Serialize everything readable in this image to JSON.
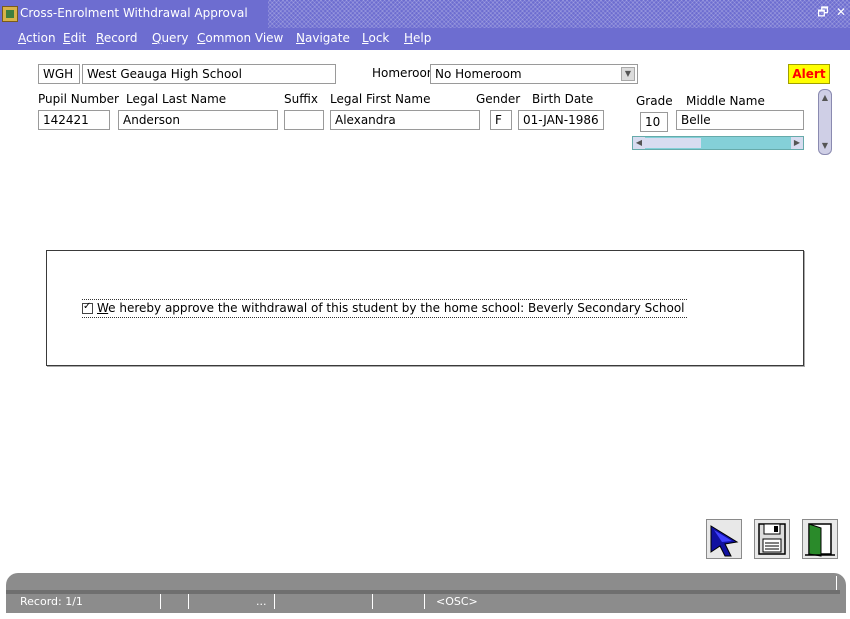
{
  "window": {
    "title": "Cross-Enrolment Withdrawal Approval",
    "restore_glyph": "🗗",
    "close_glyph": "✕"
  },
  "menu": [
    {
      "label": "Action",
      "key": "A"
    },
    {
      "label": "Edit",
      "key": "E"
    },
    {
      "label": "Record",
      "key": "R"
    },
    {
      "label": "Query",
      "key": "Q"
    },
    {
      "label": "Common View",
      "key": "C"
    },
    {
      "label": "Navigate",
      "key": "N"
    },
    {
      "label": "Lock",
      "key": "L"
    },
    {
      "label": "Help",
      "key": "H"
    }
  ],
  "school": {
    "code": "WGH",
    "name": "West Geauga High School"
  },
  "homeroom": {
    "label": "Homeroom",
    "value": "No Homeroom"
  },
  "alert": {
    "label": "Alert",
    "bg": "#ffff00",
    "fg": "#ff0000"
  },
  "student": {
    "labels": {
      "pupil_number": "Pupil Number",
      "legal_last_name": "Legal Last Name",
      "suffix": "Suffix",
      "legal_first_name": "Legal First Name",
      "gender": "Gender",
      "birth_date": "Birth Date",
      "grade": "Grade",
      "middle_name": "Middle Name"
    },
    "values": {
      "pupil_number": "142421",
      "legal_last_name": "Anderson",
      "suffix": "",
      "legal_first_name": "Alexandra",
      "gender": "F",
      "birth_date": "01-JAN-1986",
      "grade": "10",
      "middle_name": "Belle"
    }
  },
  "approval": {
    "checked": true,
    "text_underlined": "W",
    "text_rest": "e hereby approve the withdrawal of this student by the home school: Beverly Secondary School"
  },
  "toolbar": {
    "icons": [
      "pointer-icon",
      "save-icon",
      "exit-icon"
    ]
  },
  "status": {
    "record": "Record: 1/1",
    "ellipsis": "...",
    "mode": "<OSC>"
  },
  "colors": {
    "titlebar": "#6d6dd0",
    "statusbar": "#8c8c8c",
    "hscroll": "#84d0d8"
  }
}
